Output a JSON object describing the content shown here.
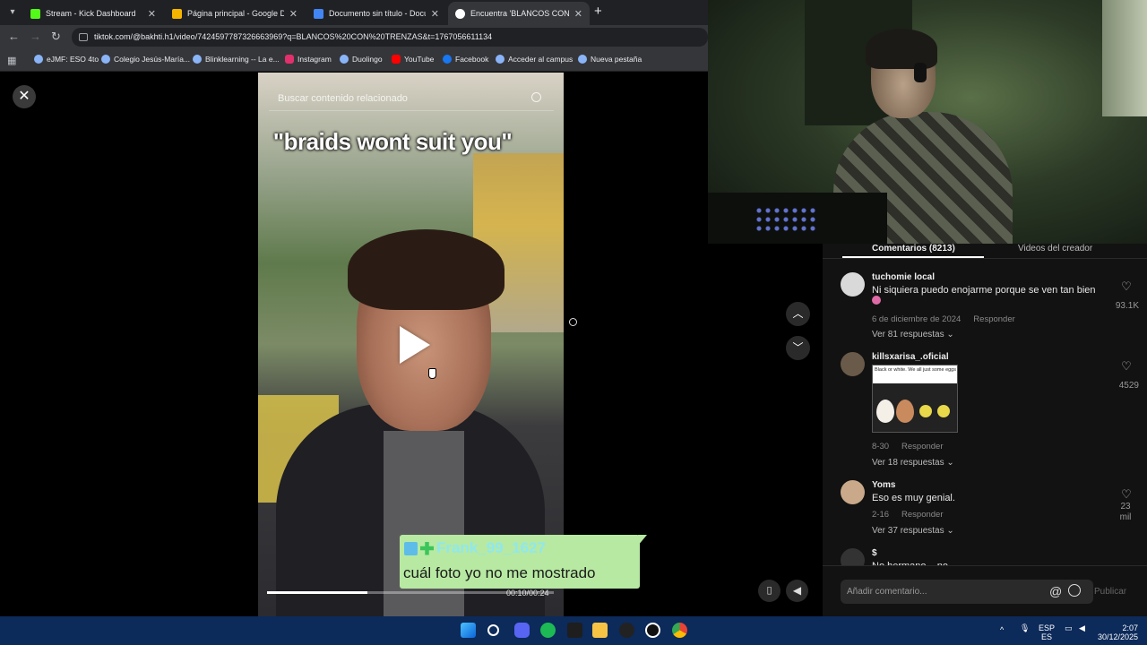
{
  "browser": {
    "tabs": [
      {
        "title": "Stream - Kick Dashboard",
        "color": "#53fc18",
        "active": false
      },
      {
        "title": "Página principal - Google Drive",
        "color": "#f4b400",
        "active": false
      },
      {
        "title": "Documento sin título - Documentos",
        "color": "#4285f4",
        "active": false
      },
      {
        "title": "Encuentra 'BLANCOS CON TRENZAS'",
        "color": "#ffffff",
        "active": true
      }
    ],
    "url": "tiktok.com/@bakhti.h1/video/7424597787326663969?q=BLANCOS%20CON%20TRENZAS&t=1767056611134",
    "bookmarks": [
      "eJMF: ESO 4to",
      "Colegio Jesús-María...",
      "Blinklearning -- La e...",
      "Instagram",
      "Duolingo",
      "YouTube",
      "Facebook",
      "Acceder al campus",
      "Nueva pestaña"
    ]
  },
  "video": {
    "search_placeholder": "Buscar contenido relacionado",
    "caption": "\"braids wont suit you\"",
    "time": "00:10/00:24",
    "progress": 0.35
  },
  "chat": {
    "username": "Frank_99_1627",
    "message": "cuál foto yo no me mostrado"
  },
  "panel": {
    "tab_comments": "Comentarios (8213)",
    "tab_creator": "Videos del creador",
    "comments": [
      {
        "user": "tuchomie local",
        "text": "Ni siquiera puedo enojarme porque se ven tan bien",
        "date": "6 de diciembre de 2024",
        "reply": "Responder",
        "replies": "Ver 81 respuestas",
        "likes": "93.1K",
        "avatar_color": "#d9d9d9"
      },
      {
        "user": "killsxarisa_.oficial",
        "text": "",
        "image_caption": "Black or white. We all just some eggs",
        "date": "8-30",
        "reply": "Responder",
        "replies": "Ver 18 respuestas",
        "likes": "4529",
        "avatar_color": "#6a5a4a"
      },
      {
        "user": "Yoms",
        "text": "Eso es muy genial.",
        "date": "2-16",
        "reply": "Responder",
        "replies": "Ver 37 respuestas",
        "likes": "23 mil",
        "avatar_color": "#c9a98a"
      },
      {
        "user": "$",
        "text": "No hermano... no...",
        "avatar_color": "#333333"
      }
    ],
    "input_placeholder": "Añadir comentario...",
    "publish_label": "Publicar"
  },
  "taskbar": {
    "lang_top": "ESP",
    "lang_bottom": "ES",
    "time": "2:07",
    "date": "30/12/2025"
  }
}
